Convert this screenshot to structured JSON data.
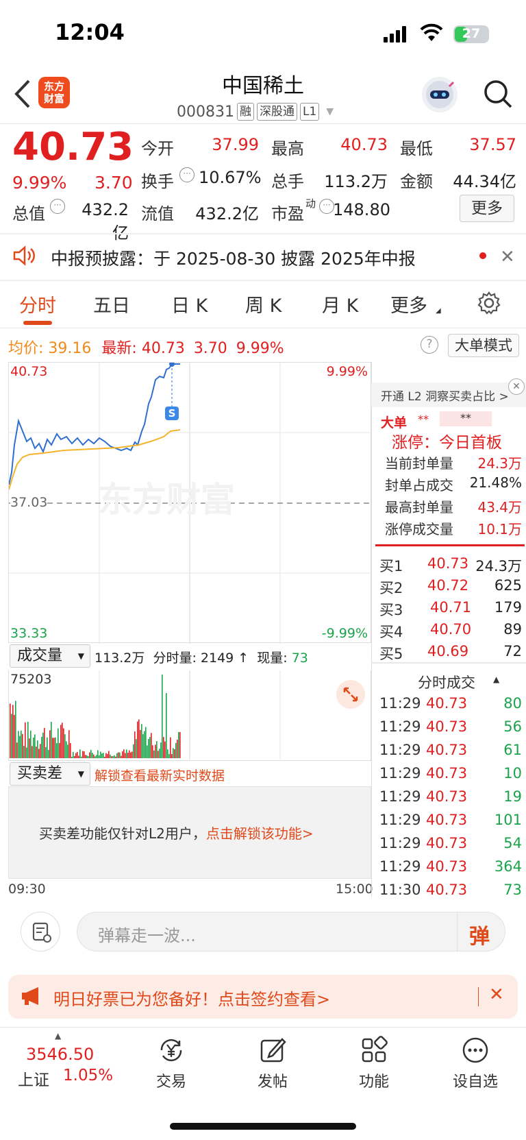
{
  "status": {
    "time": "12:04",
    "battery": "27"
  },
  "header": {
    "logo_line1": "东方",
    "logo_line2": "财富",
    "name": "中国稀土",
    "code": "000831",
    "tags": [
      "融",
      "深股通",
      "L1"
    ]
  },
  "quote": {
    "price": "40.73",
    "change_pct": "9.99%",
    "change_val": "3.70",
    "open_label": "今开",
    "open": "37.99",
    "high_label": "最高",
    "high": "40.73",
    "low_label": "最低",
    "low": "37.57",
    "turnover_label": "换手",
    "turnover": "10.67%",
    "volume_label": "总手",
    "volume": "113.2万",
    "amount_label": "金额",
    "amount": "44.34亿",
    "mktcap_label": "总值",
    "mktcap": "432.2亿",
    "float_label": "流值",
    "float_cap": "432.2亿",
    "pe_label": "市盈",
    "pe_sup": "动",
    "pe": "148.80",
    "more": "更多"
  },
  "notice": {
    "text": "中报预披露：于 2025-08-30 披露 2025年中报"
  },
  "tabs": [
    "分时",
    "五日",
    "日 K",
    "周 K",
    "月 K",
    "更多"
  ],
  "info_row": {
    "avg_label": "均价:",
    "avg": "39.16",
    "latest_label": "最新:",
    "latest": "40.73",
    "chg": "3.70",
    "pct": "9.99%",
    "mode_btn": "大单模式"
  },
  "chart": {
    "top_left": "40.73",
    "top_right": "9.99%",
    "mid": "37.03",
    "bottom_left": "33.33",
    "bottom_right": "-9.99%",
    "marker": "S",
    "watermark": "东方财富",
    "time_start": "09:30",
    "time_end": "15:00"
  },
  "volume": {
    "selector": "成交量",
    "total": "113.2万",
    "tick_label": "分时量: 2149 ↑",
    "now_label": "现量:",
    "now": "73",
    "max": "75203"
  },
  "diff": {
    "selector": "买卖差",
    "unlock_hint": "解锁查看最新实时数据",
    "panel_text": "买卖差功能仅针对L2用户，",
    "panel_link": "点击解锁该功能>"
  },
  "l2": {
    "promo": "开通 L2 洞察买卖占比 >",
    "big_label": "大单",
    "big_val1": "**",
    "big_val2": "**",
    "limit_title": "涨停：今日首板",
    "rows": [
      {
        "label": "当前封单量",
        "value": "24.3万"
      },
      {
        "label": "封单占成交",
        "value": "21.48%"
      },
      {
        "label": "最高封单量",
        "value": "43.4万"
      },
      {
        "label": "涨停成交量",
        "value": "10.1万"
      }
    ]
  },
  "orderbook": [
    {
      "label": "买1",
      "price": "40.73",
      "vol": "24.3万"
    },
    {
      "label": "买2",
      "price": "40.72",
      "vol": "625"
    },
    {
      "label": "买3",
      "price": "40.71",
      "vol": "179"
    },
    {
      "label": "买4",
      "price": "40.70",
      "vol": "89"
    },
    {
      "label": "买5",
      "price": "40.69",
      "vol": "72"
    }
  ],
  "trades": {
    "title": "分时成交",
    "rows": [
      {
        "time": "11:29",
        "price": "40.73",
        "vol": "80"
      },
      {
        "time": "11:29",
        "price": "40.73",
        "vol": "56"
      },
      {
        "time": "11:29",
        "price": "40.73",
        "vol": "61"
      },
      {
        "time": "11:29",
        "price": "40.73",
        "vol": "10"
      },
      {
        "time": "11:29",
        "price": "40.73",
        "vol": "19"
      },
      {
        "time": "11:29",
        "price": "40.73",
        "vol": "101"
      },
      {
        "time": "11:29",
        "price": "40.73",
        "vol": "54"
      },
      {
        "time": "11:29",
        "price": "40.73",
        "vol": "364"
      },
      {
        "time": "11:30",
        "price": "40.73",
        "vol": "73"
      }
    ]
  },
  "comment": {
    "placeholder": "弹幕走一波...",
    "danmaku_btn": "弹"
  },
  "promo": {
    "text": "明日好票已为您备好！点击签约查看>"
  },
  "bottom_nav": {
    "index_value": "3546.50",
    "index_name": "上证",
    "index_pct": "1.05%",
    "items": [
      "交易",
      "发帖",
      "功能",
      "设自选"
    ]
  },
  "colors": {
    "up": "#e02020",
    "down": "#1aa34a",
    "accent": "#e0491a",
    "avg_line": "#f5b32a",
    "price_line": "#2f6fd0"
  }
}
